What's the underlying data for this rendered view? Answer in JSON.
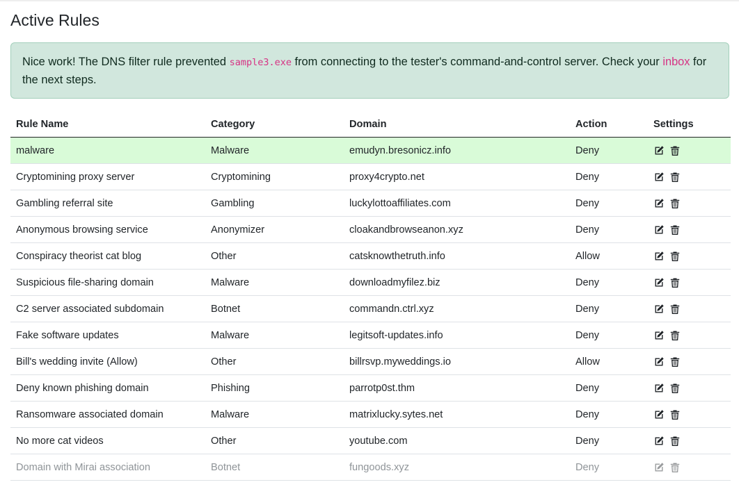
{
  "page": {
    "title": "Active Rules"
  },
  "alert": {
    "text_before": "Nice work! The DNS filter rule prevented ",
    "filename": "sample3.exe",
    "text_middle": " from connecting to the tester's command-and-control server. Check your ",
    "link_label": "inbox",
    "text_after": " for the next steps."
  },
  "table": {
    "headers": [
      "Rule Name",
      "Category",
      "Domain",
      "Action",
      "Settings"
    ],
    "rows": [
      {
        "name": "malware",
        "category": "Malware",
        "domain": "emudyn.bresonicz.info",
        "action": "Deny"
      },
      {
        "name": "Cryptomining proxy server",
        "category": "Cryptomining",
        "domain": "proxy4crypto.net",
        "action": "Deny"
      },
      {
        "name": "Gambling referral site",
        "category": "Gambling",
        "domain": "luckylottoaffiliates.com",
        "action": "Deny"
      },
      {
        "name": "Anonymous browsing service",
        "category": "Anonymizer",
        "domain": "cloakandbrowseanon.xyz",
        "action": "Deny"
      },
      {
        "name": "Conspiracy theorist cat blog",
        "category": "Other",
        "domain": "catsknowthetruth.info",
        "action": "Allow"
      },
      {
        "name": "Suspicious file-sharing domain",
        "category": "Malware",
        "domain": "downloadmyfilez.biz",
        "action": "Deny"
      },
      {
        "name": "C2 server associated subdomain",
        "category": "Botnet",
        "domain": "commandn.ctrl.xyz",
        "action": "Deny"
      },
      {
        "name": "Fake software updates",
        "category": "Malware",
        "domain": "legitsoft-updates.info",
        "action": "Deny"
      },
      {
        "name": "Bill's wedding invite (Allow)",
        "category": "Other",
        "domain": "billrsvp.myweddings.io",
        "action": "Allow"
      },
      {
        "name": "Deny known phishing domain",
        "category": "Phishing",
        "domain": "parrotp0st.thm",
        "action": "Deny"
      },
      {
        "name": "Ransomware associated domain",
        "category": "Malware",
        "domain": "matrixlucky.sytes.net",
        "action": "Deny"
      },
      {
        "name": "No more cat videos",
        "category": "Other",
        "domain": "youtube.com",
        "action": "Deny"
      },
      {
        "name": "Domain with Mirai association",
        "category": "Botnet",
        "domain": "fungoods.xyz",
        "action": "Deny"
      }
    ]
  },
  "icons": {
    "edit": "edit-icon",
    "delete": "trash-icon"
  },
  "colors": {
    "highlight_row": "#d9fbd8",
    "alert_bg": "#d1e7dd",
    "code_accent": "#d63384"
  }
}
